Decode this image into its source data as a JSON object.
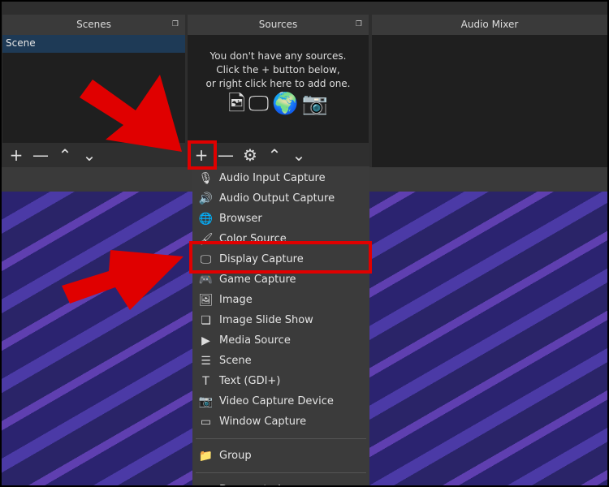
{
  "scenes": {
    "title": "Scenes",
    "items": [
      "Scene"
    ]
  },
  "sources": {
    "title": "Sources",
    "empty_lines": [
      "You don't have any sources.",
      "Click the + button below,",
      "or right click here to add one."
    ],
    "icons": [
      "image-icon",
      "monitor-icon",
      "globe-icon",
      "camera-icon"
    ]
  },
  "audio_mixer": {
    "title": "Audio Mixer"
  },
  "toolbar": {
    "add": "+",
    "remove": "—",
    "settings": "⚙",
    "up": "⌃",
    "down": "⌄"
  },
  "menu": {
    "items": [
      {
        "label": "Audio Input Capture",
        "icon": "🎙"
      },
      {
        "label": "Audio Output Capture",
        "icon": "🔊"
      },
      {
        "label": "Browser",
        "icon": "🌐"
      },
      {
        "label": "Color Source",
        "icon": "🖌"
      },
      {
        "label": "Display Capture",
        "icon": "🖵"
      },
      {
        "label": "Game Capture",
        "icon": "🎮"
      },
      {
        "label": "Image",
        "icon": "🖼"
      },
      {
        "label": "Image Slide Show",
        "icon": "❏"
      },
      {
        "label": "Media Source",
        "icon": "▶"
      },
      {
        "label": "Scene",
        "icon": "☰"
      },
      {
        "label": "Text (GDI+)",
        "icon": "T"
      },
      {
        "label": "Video Capture Device",
        "icon": "📷"
      },
      {
        "label": "Window Capture",
        "icon": "▭"
      }
    ],
    "group": {
      "label": "Group",
      "icon": "📁"
    },
    "deprecated": {
      "label": "Deprecated",
      "arrow": "▸"
    }
  },
  "annotation_color": "#e00000"
}
